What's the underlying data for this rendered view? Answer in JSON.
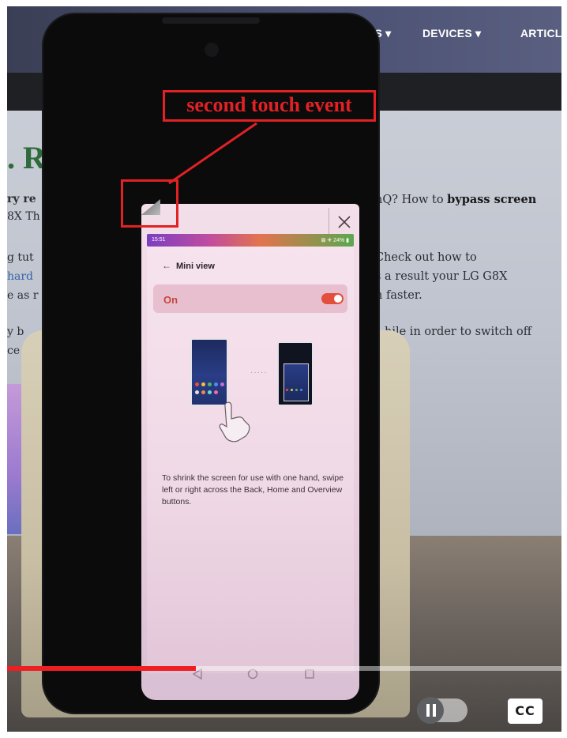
{
  "website": {
    "nav": [
      "ES ▾",
      "DEVICES ▾",
      "ARTICL"
    ],
    "heading_fragment": ". R",
    "right_lines": [
      {
        "pre": "nQ? How to ",
        "bold": "bypass screen",
        "post": ""
      },
      {
        "pre": "Check out how to",
        "bold": "",
        "post": ""
      },
      {
        "pre": "s a result your LG G8X",
        "bold": "",
        "post": ""
      },
      {
        "pre": "n faster.",
        "bold": "",
        "post": ""
      },
      {
        "pre": "hile in order to switch off",
        "bold": "",
        "post": ""
      }
    ],
    "left_fragments": [
      "ry re",
      "8X Th",
      "g tut",
      "hard",
      "e as r",
      "y b",
      "ce"
    ]
  },
  "annotation": {
    "label": "second touch event",
    "color": "#e12124"
  },
  "mini_view": {
    "status_time": "15:51",
    "status_right": "⊠ ⁜ 24% ▮",
    "back_glyph": "←",
    "title": "Mini view",
    "toggle_label": "On",
    "toggle_on": true,
    "separator_dots": "·····",
    "description": "To shrink the screen for use with one hand, swipe left or right across the Back, Home and Overview buttons.",
    "nav_icons": [
      "back-triangle",
      "home-circle",
      "overview-square"
    ],
    "close_icon": "close-icon"
  },
  "video_controls": {
    "progress_fraction": 0.34,
    "progress_color": "#ee1f22",
    "autoplay_toggle": "paused",
    "cc_label": "CC"
  }
}
